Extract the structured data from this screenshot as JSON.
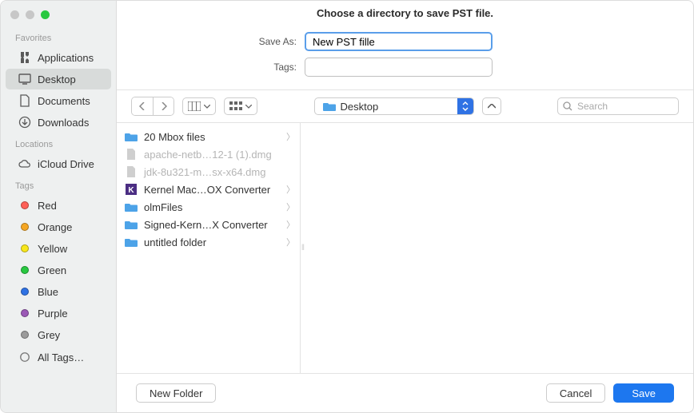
{
  "window": {
    "title": "Choose a directory to save PST file.",
    "traffic": {
      "close": "#c7c7c7",
      "min": "#c7c7c7",
      "zoom": "#28c840"
    }
  },
  "sidebar": {
    "favorites_label": "Favorites",
    "favorites": [
      {
        "label": "Applications",
        "icon": "apps"
      },
      {
        "label": "Desktop",
        "icon": "desktop",
        "selected": true
      },
      {
        "label": "Documents",
        "icon": "doc"
      },
      {
        "label": "Downloads",
        "icon": "download"
      }
    ],
    "locations_label": "Locations",
    "locations": [
      {
        "label": "iCloud Drive",
        "icon": "cloud"
      }
    ],
    "tags_label": "Tags",
    "tags": [
      {
        "label": "Red",
        "color": "#ff5f57"
      },
      {
        "label": "Orange",
        "color": "#f5a623"
      },
      {
        "label": "Yellow",
        "color": "#f8e71c"
      },
      {
        "label": "Green",
        "color": "#28c840"
      },
      {
        "label": "Blue",
        "color": "#2f72e4"
      },
      {
        "label": "Purple",
        "color": "#9b59b6"
      },
      {
        "label": "Grey",
        "color": "#9b9b9b"
      }
    ],
    "all_tags_label": "All Tags…"
  },
  "form": {
    "save_as_label": "Save As:",
    "save_as_value": "New PST fille",
    "tags_label": "Tags:",
    "tags_value": ""
  },
  "toolbar": {
    "path_label": "Desktop",
    "search_placeholder": "Search"
  },
  "files": [
    {
      "label": "20 Mbox  files",
      "kind": "folder",
      "dim": false,
      "chev": true
    },
    {
      "label": "apache-netb…12-1 (1).dmg",
      "kind": "doc",
      "dim": true,
      "chev": false
    },
    {
      "label": "jdk-8u321-m…sx-x64.dmg",
      "kind": "doc",
      "dim": true,
      "chev": false
    },
    {
      "label": "Kernel Mac…OX Converter",
      "kind": "app",
      "dim": false,
      "chev": true
    },
    {
      "label": "olmFiles",
      "kind": "folder",
      "dim": false,
      "chev": true
    },
    {
      "label": "Signed-Kern…X Converter",
      "kind": "folder",
      "dim": false,
      "chev": true
    },
    {
      "label": "untitled folder",
      "kind": "folder",
      "dim": false,
      "chev": true
    }
  ],
  "footer": {
    "new_folder": "New Folder",
    "cancel": "Cancel",
    "save": "Save"
  }
}
